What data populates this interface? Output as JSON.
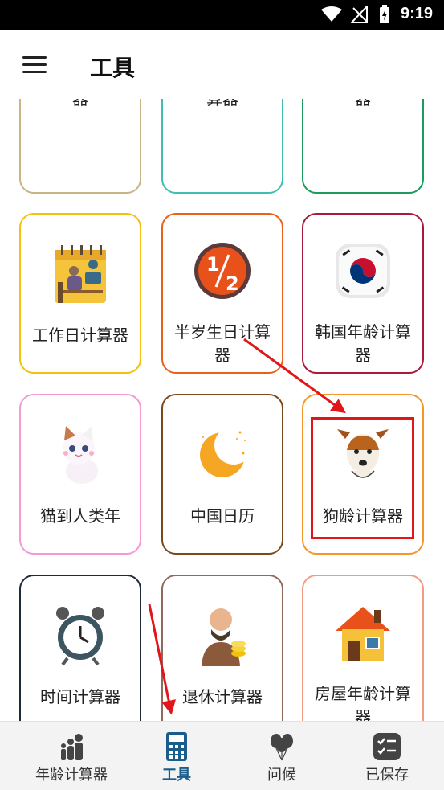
{
  "status_bar": {
    "time": "9:19"
  },
  "app_bar": {
    "title": "工具",
    "menu_icon": "hamburger-menu-icon"
  },
  "tools": [
    {
      "id": "baby",
      "label": "婴儿年龄计算器",
      "icon": "baby-icon",
      "border": "#c9b486"
    },
    {
      "id": "parkinson",
      "label": "皮尔逊年龄计算器",
      "icon": "calculator-keypad-icon",
      "border": "#3fbfb1"
    },
    {
      "id": "fact",
      "label": "年龄事实计算器",
      "icon": "money-badge-icon",
      "border": "#1d9a5e"
    },
    {
      "id": "workday",
      "label": "工作日计算器",
      "icon": "workday-calendar-icon",
      "border": "#f2c10f"
    },
    {
      "id": "half-birthday",
      "label": "半岁生日计算器",
      "icon": "half-badge-icon",
      "border": "#e8621a"
    },
    {
      "id": "korean",
      "label": "韩国年龄计算器",
      "icon": "korea-flag-icon",
      "border": "#a8193a"
    },
    {
      "id": "cat",
      "label": "猫到人类年",
      "icon": "cat-icon",
      "border": "#f29ad6"
    },
    {
      "id": "lunar",
      "label": "中国日历",
      "icon": "moon-icon",
      "border": "#7a4a1c"
    },
    {
      "id": "dog",
      "label": "狗龄计算器",
      "icon": "dog-icon",
      "border": "#f5962b"
    },
    {
      "id": "time",
      "label": "时间计算器",
      "icon": "alarm-clock-icon",
      "border": "#1c2a3a"
    },
    {
      "id": "retire",
      "label": "退休计算器",
      "icon": "retiree-icon",
      "border": "#8c6a5c"
    },
    {
      "id": "house",
      "label": "房屋年龄计算器",
      "icon": "house-icon",
      "border": "#f29a82"
    }
  ],
  "bottom_nav": [
    {
      "label": "年龄计算器",
      "icon": "family-icon",
      "active": false
    },
    {
      "label": "工具",
      "icon": "calculator-icon",
      "active": true
    },
    {
      "label": "问候",
      "icon": "balloons-icon",
      "active": false
    },
    {
      "label": "已保存",
      "icon": "checklist-icon",
      "active": false
    }
  ],
  "colors": {
    "accent": "#1a5d8a",
    "highlight": "#e0161b"
  }
}
